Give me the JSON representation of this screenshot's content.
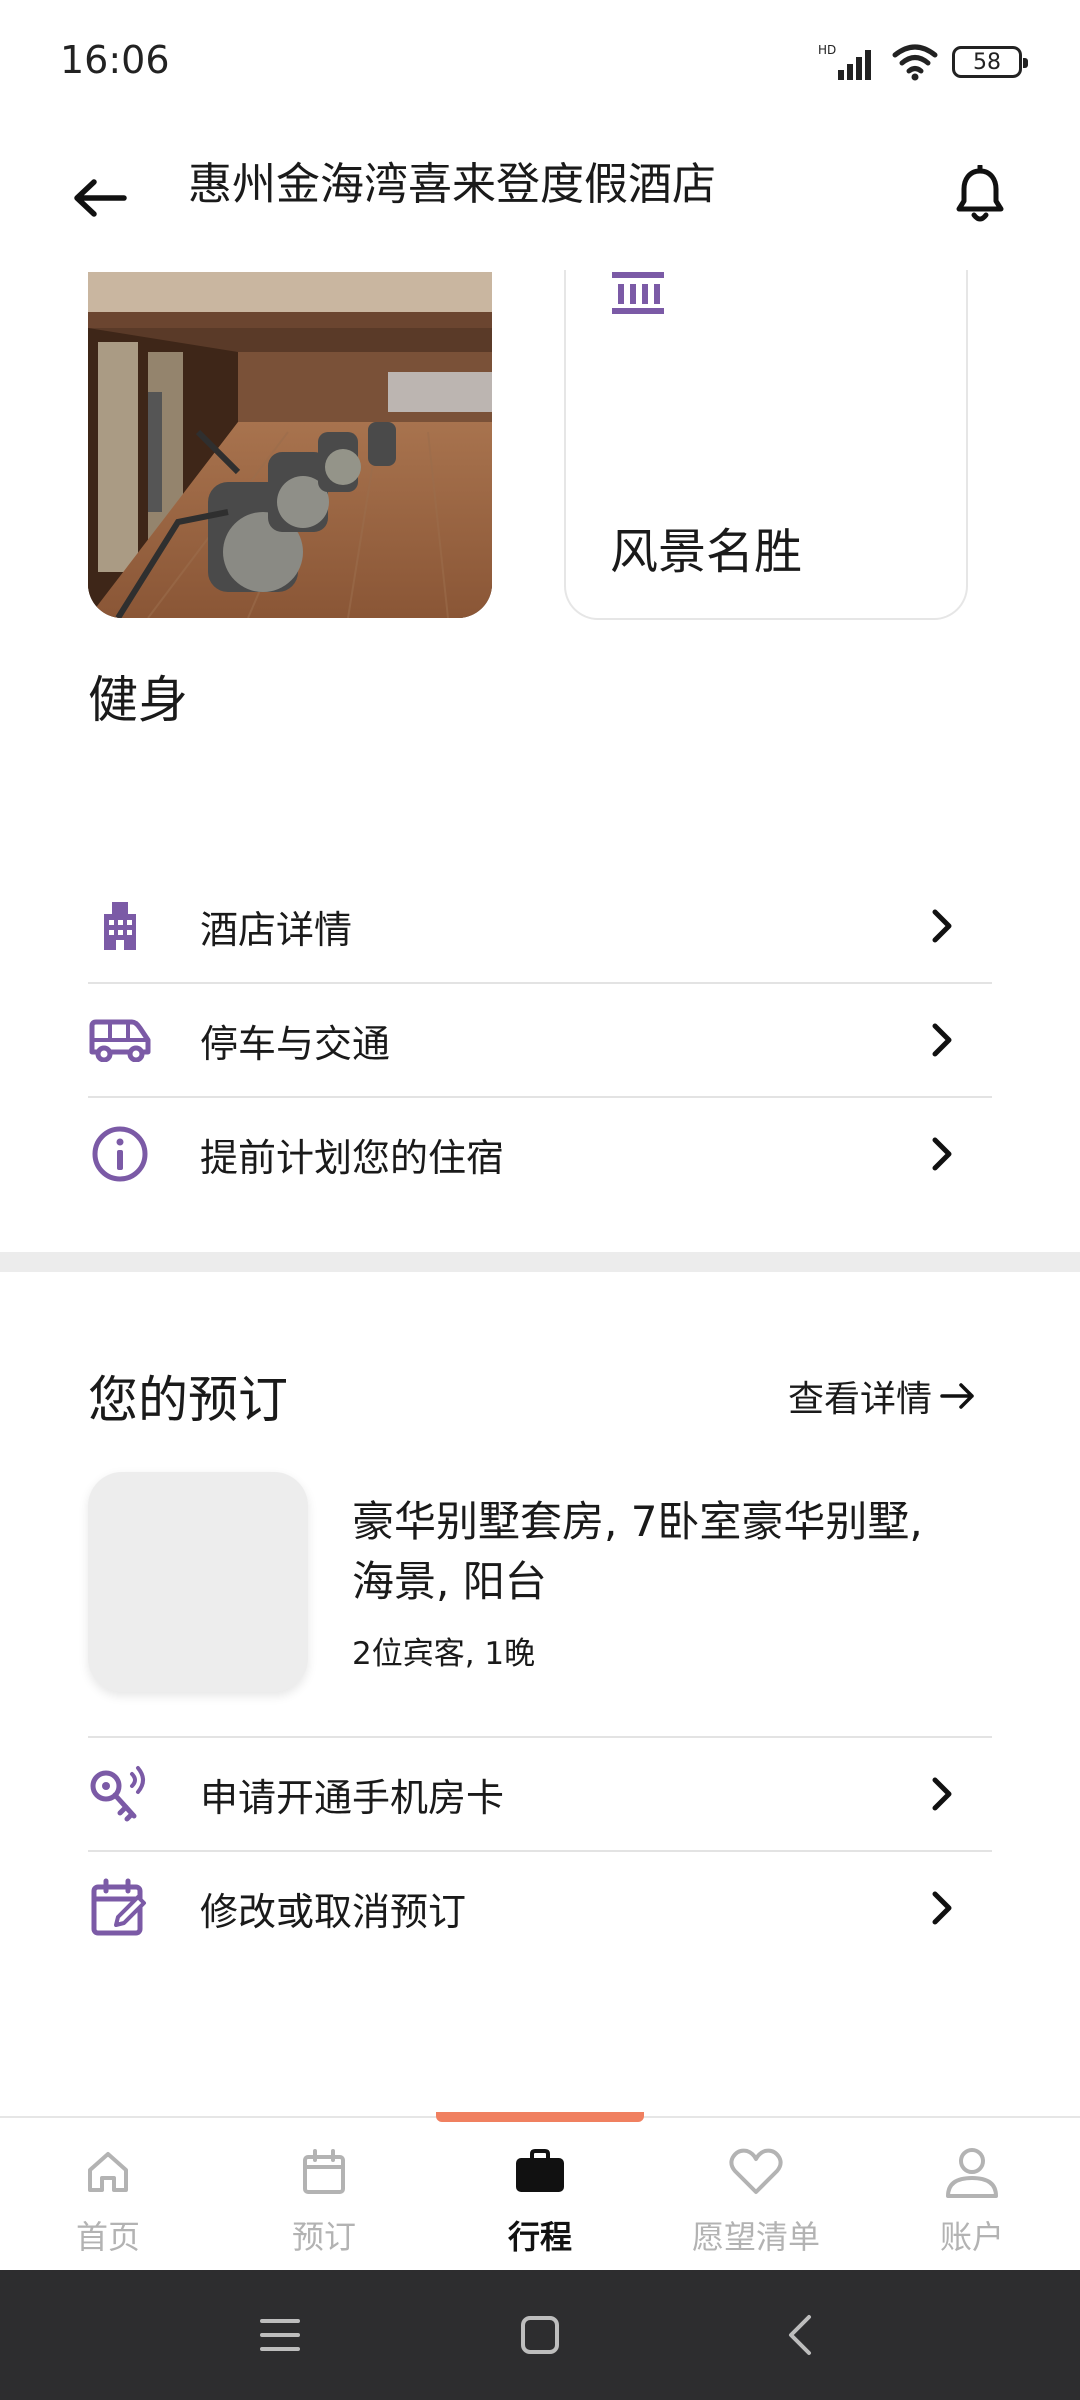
{
  "status_bar": {
    "time": "16:06",
    "network": "HD",
    "battery": "58"
  },
  "header": {
    "title": "惠州金海湾喜来登度假酒店"
  },
  "amenities": [
    {
      "label": "健身",
      "icon": "fitness-photo"
    },
    {
      "label": "风景名胜",
      "icon": "landmark-icon"
    }
  ],
  "hotel_links": [
    {
      "label": "酒店详情",
      "icon": "building-icon"
    },
    {
      "label": "停车与交通",
      "icon": "van-icon"
    },
    {
      "label": "提前计划您的住宿",
      "icon": "info-icon"
    }
  ],
  "booking": {
    "title": "您的预订",
    "view_details": "查看详情",
    "room_name": "豪华别墅套房, 7卧室豪华别墅, 海景, 阳台",
    "room_meta": "2位宾客, 1晚",
    "actions": [
      {
        "label": "申请开通手机房卡",
        "icon": "key-icon"
      },
      {
        "label": "修改或取消预订",
        "icon": "calendar-edit-icon"
      }
    ]
  },
  "bottom_nav": {
    "items": [
      {
        "label": "首页",
        "icon": "home-icon"
      },
      {
        "label": "预订",
        "icon": "calendar-icon"
      },
      {
        "label": "行程",
        "icon": "briefcase-icon",
        "active": true
      },
      {
        "label": "愿望清单",
        "icon": "heart-icon"
      },
      {
        "label": "账户",
        "icon": "user-icon"
      }
    ]
  },
  "colors": {
    "accent_purple": "#7b5aa6",
    "nav_indicator": "#f08060",
    "inactive": "#b3b3b3"
  }
}
